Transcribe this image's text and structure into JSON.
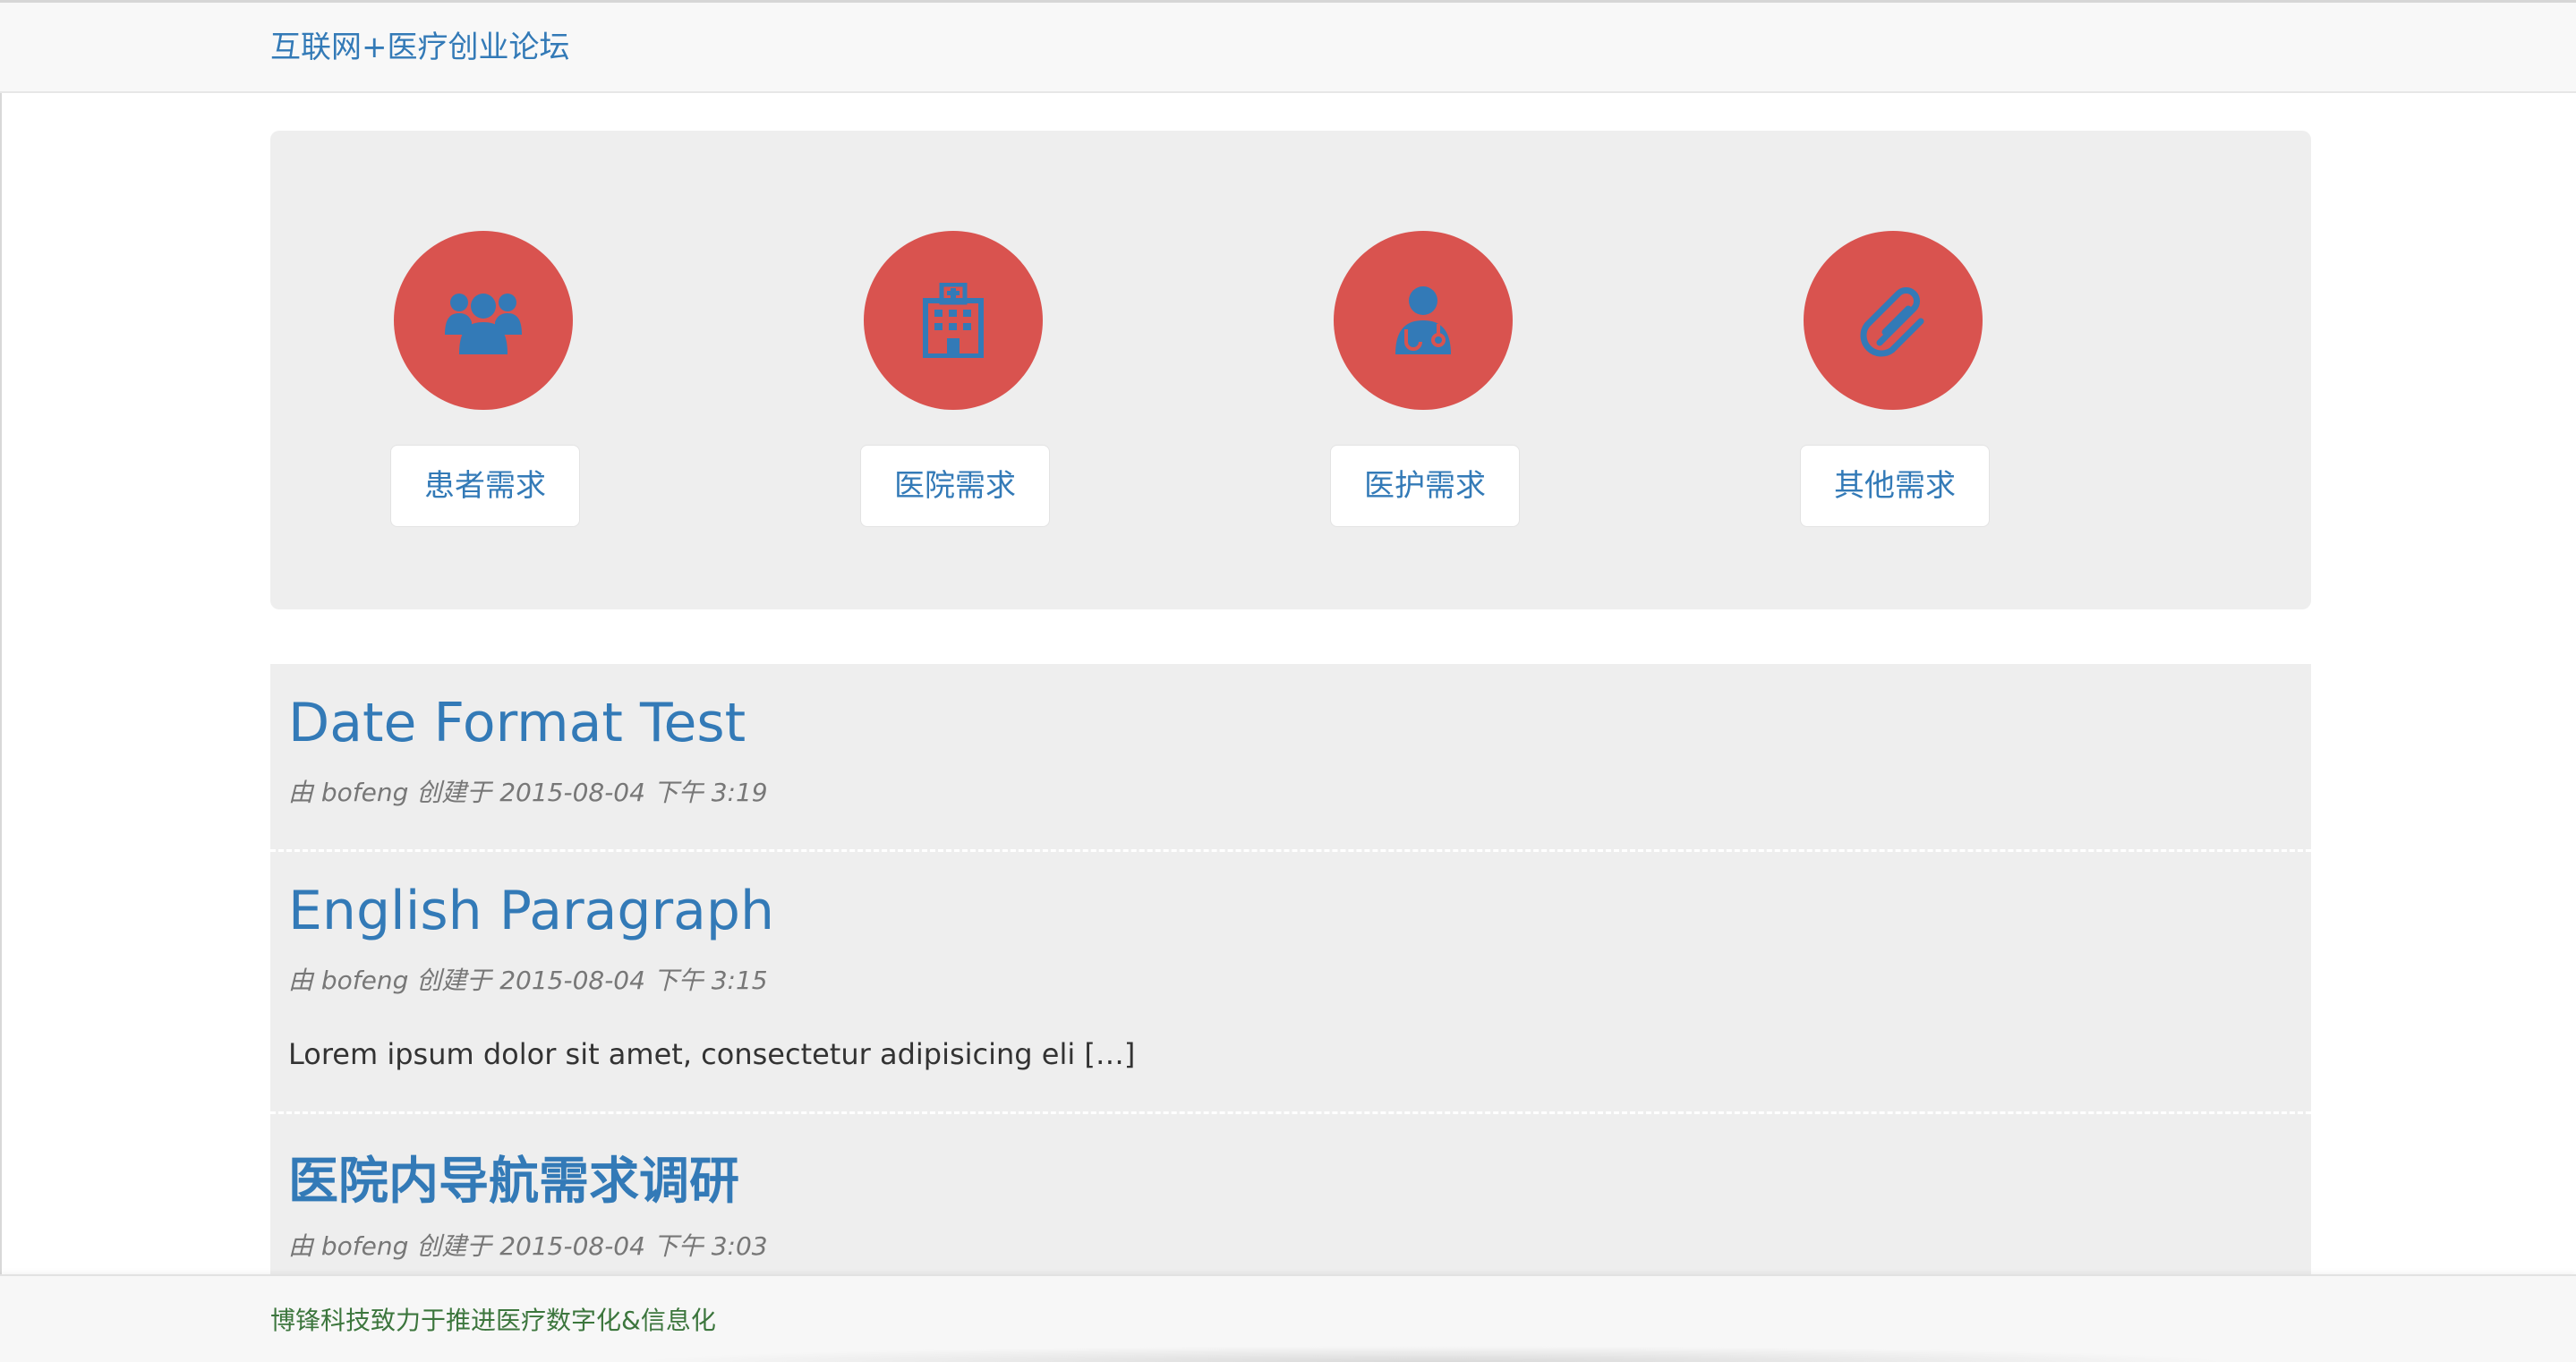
{
  "navbar": {
    "brand": "互联网+医疗创业论坛"
  },
  "categories": [
    {
      "label": "患者需求",
      "icon": "users-icon"
    },
    {
      "label": "医院需求",
      "icon": "hospital-icon"
    },
    {
      "label": "医护需求",
      "icon": "doctor-icon"
    },
    {
      "label": "其他需求",
      "icon": "paperclip-icon"
    }
  ],
  "posts": [
    {
      "title": "Date Format Test",
      "meta": "由 bofeng 创建于 2015-08-04 下午 3:19",
      "excerpt": ""
    },
    {
      "title": "English Paragraph",
      "meta": "由 bofeng 创建于 2015-08-04 下午 3:15",
      "excerpt": "Lorem ipsum dolor sit amet, consectetur adipisicing eli […]"
    },
    {
      "title": "医院内导航需求调研",
      "meta": "由 bofeng 创建于 2015-08-04 下午 3:03",
      "excerpt": ""
    }
  ],
  "footer": {
    "text": "博锋科技致力于推进医疗数字化&信息化"
  },
  "colors": {
    "accent": "#337ab7",
    "circle": "#d9534f",
    "panel": "#eeeeee",
    "footer_text": "#3c763d"
  }
}
